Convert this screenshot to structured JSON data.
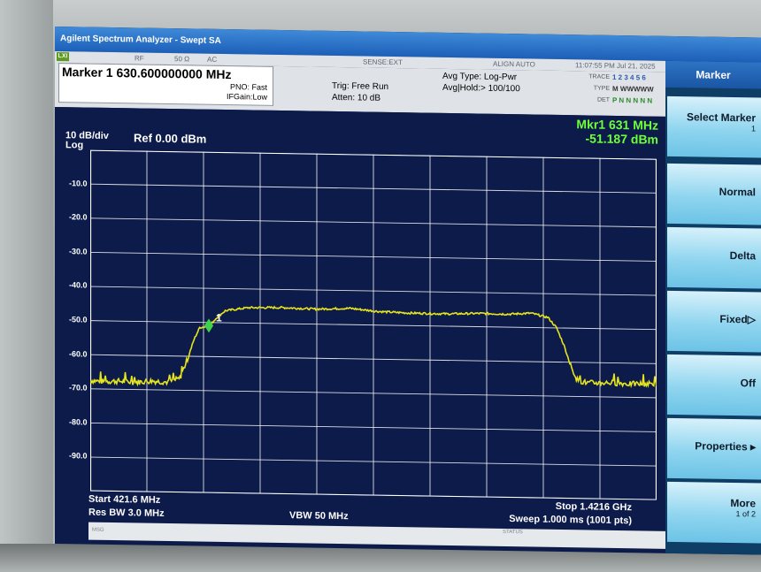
{
  "window": {
    "title": "Agilent Spectrum Analyzer - Swept SA"
  },
  "status_bar": {
    "lxi": "LXI",
    "rf": "RF",
    "impedance": "50 Ω",
    "coupling": "AC",
    "sense": "SENSE:EXT",
    "align": "ALIGN AUTO",
    "datetime": "11:07:55 PM Jul 21, 2025"
  },
  "marker_info": {
    "title": "Marker 1  630.600000000 MHz",
    "pno": "PNO: Fast",
    "ifgain": "IFGain:Low",
    "trig": "Trig: Free Run",
    "atten": "Atten: 10 dB",
    "avg_type": "Avg Type: Log-Pwr",
    "avg_hold": "Avg|Hold:> 100/100"
  },
  "trace_panel": {
    "trace_label": "TRACE",
    "type_label": "TYPE",
    "det_label": "DET",
    "trace_value": "1 2 3 4 5 6",
    "type_value": "M WWWWW",
    "det_value": "P N N N N N"
  },
  "readout": {
    "marker_freq": "Mkr1 631 MHz",
    "marker_level": "-51.187 dBm",
    "scale": "10 dB/div",
    "scale_type": "Log",
    "ref_level": "Ref 0.00 dBm",
    "marker_flag": "1"
  },
  "y_axis_labels": [
    "-10.0",
    "-20.0",
    "-30.0",
    "-40.0",
    "-50.0",
    "-60.0",
    "-70.0",
    "-80.0",
    "-90.0"
  ],
  "footer": {
    "start": "Start 421.6 MHz",
    "res_bw": "Res BW 3.0 MHz",
    "vbw": "VBW 50 MHz",
    "stop": "Stop 1.4216 GHz",
    "sweep": "Sweep  1.000 ms (1001 pts)"
  },
  "msg_bar": {
    "msg": "MSG",
    "status": "STATUS"
  },
  "softkeys": {
    "header": "Marker",
    "items": [
      {
        "label": "Select Marker",
        "sub": "1"
      },
      {
        "label": "Normal",
        "sub": ""
      },
      {
        "label": "Delta",
        "sub": ""
      },
      {
        "label": "Fixed▷",
        "sub": ""
      },
      {
        "label": "Off",
        "sub": ""
      },
      {
        "label": "Properties ▸",
        "sub": ""
      },
      {
        "label": "More",
        "sub": "1 of 2"
      }
    ]
  },
  "colors": {
    "trace": "#e6e41c",
    "marker": "#3fd34a",
    "readout": "#6dff3a",
    "background": "#0d1b4a",
    "grid": "#ffffff"
  },
  "trace_data": {
    "x_unit": "MHz",
    "y_unit": "dBm",
    "x_range": [
      421.6,
      1421.6
    ],
    "y_range": [
      -100,
      0
    ],
    "points": [
      [
        421.6,
        -67.5
      ],
      [
        440,
        -67.8
      ],
      [
        470,
        -67.6
      ],
      [
        500,
        -67.9
      ],
      [
        530,
        -67.4
      ],
      [
        560,
        -67.7
      ],
      [
        580,
        -66.5
      ],
      [
        595,
        -60
      ],
      [
        605,
        -55
      ],
      [
        615,
        -51.5
      ],
      [
        631,
        -51.2
      ],
      [
        645,
        -48.5
      ],
      [
        660,
        -46.5
      ],
      [
        700,
        -45.5
      ],
      [
        760,
        -45.3
      ],
      [
        820,
        -45.6
      ],
      [
        880,
        -45.2
      ],
      [
        930,
        -46
      ],
      [
        980,
        -46.3
      ],
      [
        1050,
        -46.4
      ],
      [
        1110,
        -46.1
      ],
      [
        1160,
        -46.2
      ],
      [
        1200,
        -45.8
      ],
      [
        1230,
        -47
      ],
      [
        1245,
        -50
      ],
      [
        1258,
        -55
      ],
      [
        1270,
        -61
      ],
      [
        1282,
        -65.3
      ],
      [
        1300,
        -66
      ],
      [
        1340,
        -65.8
      ],
      [
        1380,
        -66.1
      ],
      [
        1421.6,
        -65.9
      ]
    ],
    "marker": {
      "x": 631,
      "y": -51.187
    }
  }
}
